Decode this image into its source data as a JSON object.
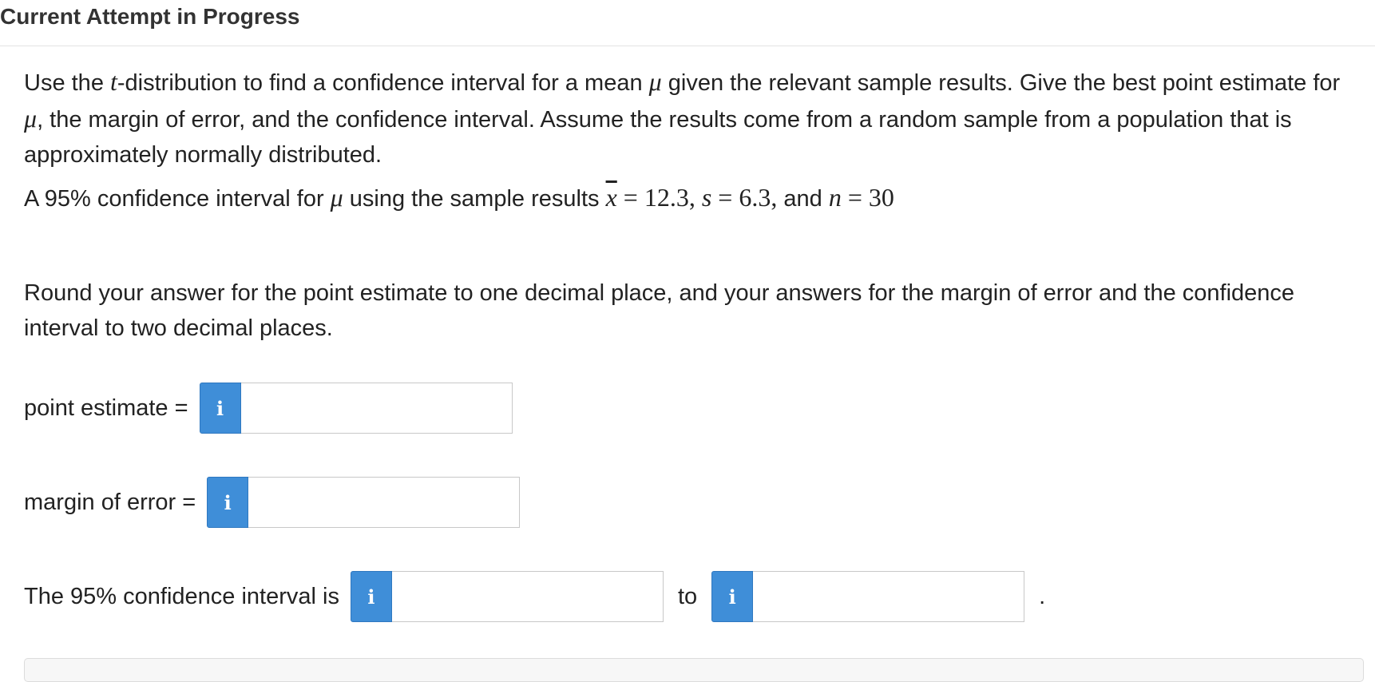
{
  "header": {
    "title": "Current Attempt in Progress"
  },
  "question": {
    "intro_1": "Use the ",
    "intro_t": "t",
    "intro_2": "-distribution to find a confidence interval for a mean ",
    "intro_mu": "μ",
    "intro_3": " given the relevant sample results. Give the best point estimate for ",
    "intro_mu2": "μ",
    "intro_4": ", the margin of error, and the confidence interval. Assume the results come from a random sample from a population that is approximately normally distributed.",
    "sample_1": "A 95% confidence interval for ",
    "sample_mu": "μ",
    "sample_2": " using the sample results ",
    "sample_xbar": "x",
    "sample_eq1": " = 12.3,",
    "sample_s": " s",
    "sample_eq2": " = 6.3,",
    "sample_and": " and ",
    "sample_n": "n",
    "sample_eq3": " = 30",
    "rounding": "Round your answer for the point estimate to one decimal place, and your answers for the margin of error and the confidence interval to two decimal places."
  },
  "answers": {
    "point_estimate_label": "point estimate =",
    "point_estimate_value": "",
    "margin_label": "margin of error =",
    "margin_value": "",
    "interval_label": "The 95% confidence interval is",
    "interval_low_value": "",
    "to_label": "to",
    "interval_high_value": "",
    "period": ".",
    "info_glyph": "i"
  },
  "colors": {
    "info_button": "#3f8ed8"
  },
  "icons": {
    "info": "info-icon"
  }
}
